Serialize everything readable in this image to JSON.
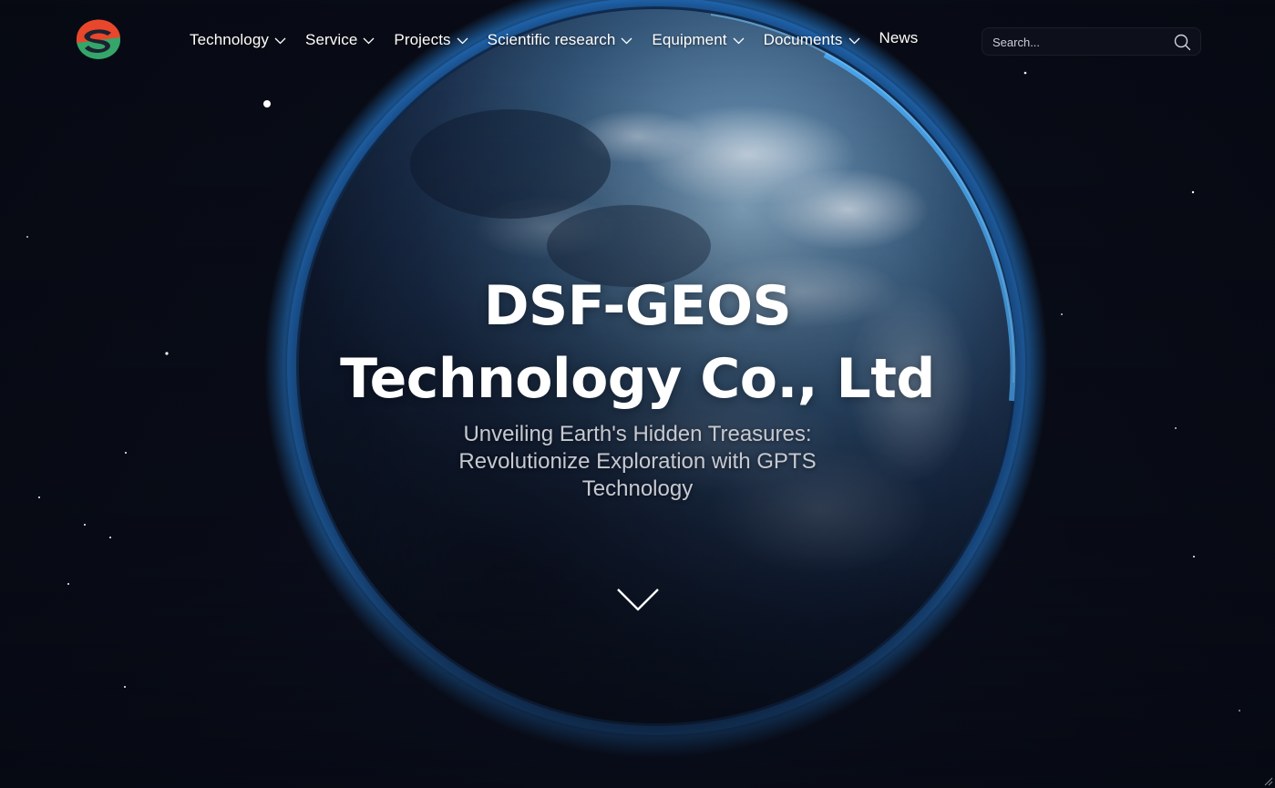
{
  "brand": {
    "colors": {
      "red": "#e8472c",
      "green": "#34a66a",
      "accent": "#2b8ff0"
    }
  },
  "nav": {
    "items": [
      {
        "label": "Technology",
        "has_dropdown": true
      },
      {
        "label": "Service",
        "has_dropdown": true
      },
      {
        "label": "Projects",
        "has_dropdown": true
      },
      {
        "label": "Scientific research",
        "has_dropdown": true
      },
      {
        "label": "Equipment",
        "has_dropdown": true
      },
      {
        "label": "Documents",
        "has_dropdown": true
      },
      {
        "label": "News",
        "has_dropdown": false
      }
    ]
  },
  "search": {
    "placeholder": "Search...",
    "value": "",
    "icon": "search-icon"
  },
  "hero": {
    "title_line1": "DSF-GEOS",
    "title_line2": "Technology Co., Ltd",
    "subtitle": "Unveiling Earth's Hidden Treasures: Revolutionize Exploration with GPTS Technology"
  },
  "scroll_indicator": {
    "icon": "chevron-down-icon"
  }
}
